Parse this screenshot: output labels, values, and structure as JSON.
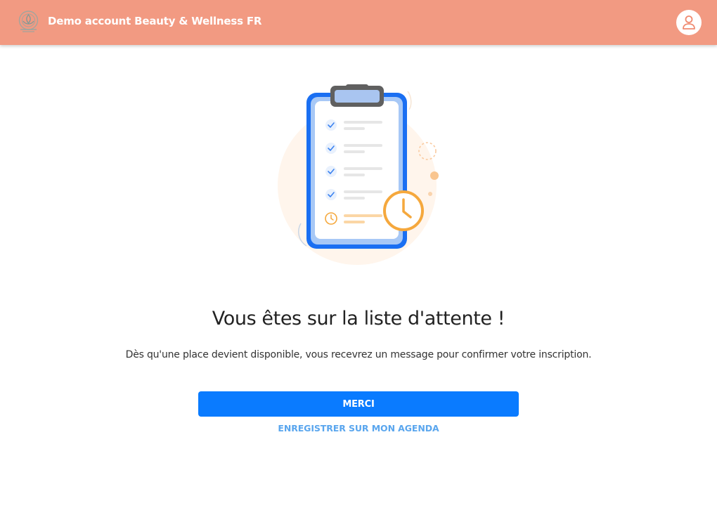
{
  "header": {
    "title": "Demo account Beauty & Wellness FR",
    "logo_icon": "lotus-bell-logo",
    "account_icon": "user-icon",
    "background": "#f29a82"
  },
  "main": {
    "illustration": "clipboard-checklist-clock-illustration",
    "heading": "Vous êtes sur la liste d'attente !",
    "message": "Dès qu'une place devient disponible, vous recevrez un message pour confirmer votre inscription.",
    "primary_button_label": "MERCI",
    "secondary_link_label": "ENREGISTRER SUR MON AGENDA",
    "accent": "#0a7bff",
    "link_color": "#5aa6ee"
  }
}
